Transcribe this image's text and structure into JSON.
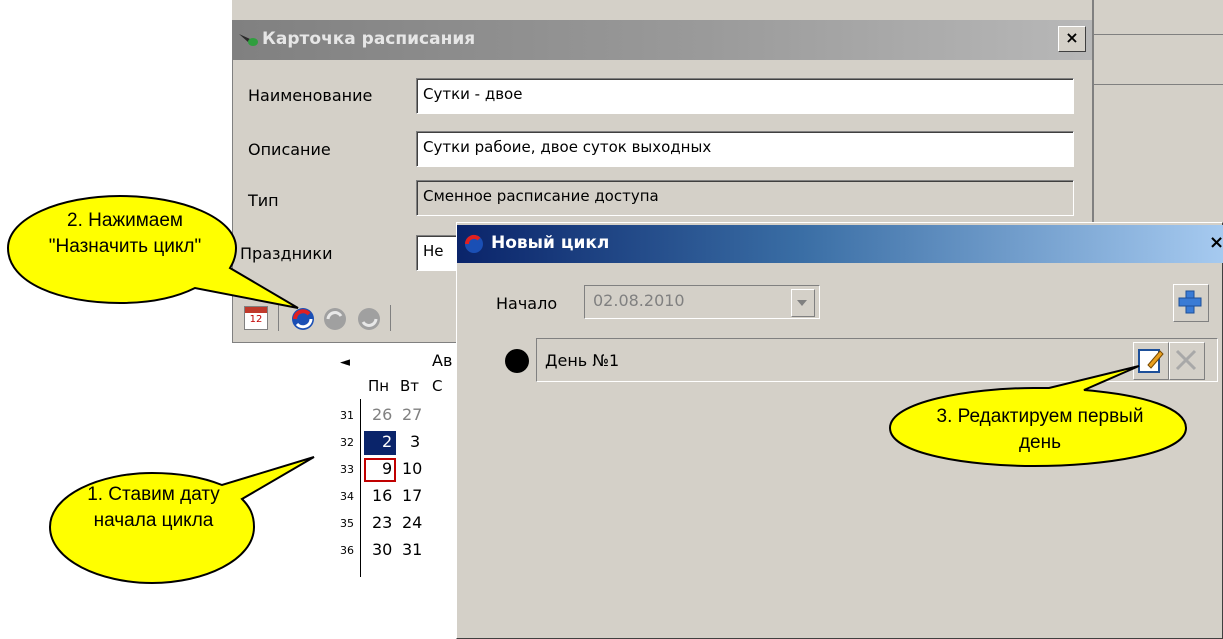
{
  "main_window": {
    "title": "Карточка расписания",
    "close": "×",
    "fields": [
      {
        "label": "Наименование",
        "value": "Сутки - двое"
      },
      {
        "label": "Описание",
        "value": "Сутки рабоие, двое суток выходных"
      },
      {
        "label": "Тип",
        "value": "Сменное расписание доступа"
      },
      {
        "label": "Праздники",
        "value": "Не"
      }
    ]
  },
  "calendar": {
    "nav_prev": "◄",
    "month": "Ав",
    "weekdays": [
      "Пн",
      "Вт",
      "С"
    ],
    "weeks": [
      {
        "num": "31",
        "days": [
          "26",
          "27"
        ]
      },
      {
        "num": "32",
        "days": [
          "2",
          "3"
        ]
      },
      {
        "num": "33",
        "days": [
          "9",
          "10"
        ]
      },
      {
        "num": "34",
        "days": [
          "16",
          "17"
        ]
      },
      {
        "num": "35",
        "days": [
          "23",
          "24"
        ]
      },
      {
        "num": "36",
        "days": [
          "30",
          "31"
        ]
      }
    ],
    "toolbar_icons": [
      "calendar-icon",
      "assign-cycle-icon",
      "cycle-icon",
      "cycle-icon-2"
    ],
    "calendar_icon_text": "12"
  },
  "dialog": {
    "title": "Новый цикл",
    "close": "×",
    "start_label": "Начало",
    "start_value": "02.08.2010",
    "day_label": "День №1"
  },
  "callouts": {
    "c1": "1. Ставим дату начала цикла",
    "c2": "2. Нажимаем \"Назначить цикл\"",
    "c3": "3. Редактируем первый день"
  },
  "colors": {
    "selected_day": "#0a246a",
    "today_border": "#c00000",
    "callout_fill": "#ffff00",
    "dialog_title": "#0a246a"
  }
}
